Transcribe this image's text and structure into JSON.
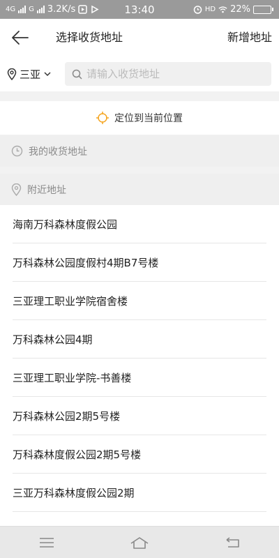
{
  "status_bar": {
    "network_1": "4G",
    "network_2": "G",
    "speed": "3.2K/s",
    "time": "13:40",
    "hd": "HD",
    "battery": "22%",
    "battery_level": 0.22
  },
  "header": {
    "title": "选择收货地址",
    "add_label": "新增地址"
  },
  "search_row": {
    "city": "三亚",
    "search_placeholder": "请输入收货地址"
  },
  "locate": {
    "label": "定位到当前位置",
    "accent": "#f5a623"
  },
  "sections": {
    "my_addresses": "我的收货地址",
    "nearby": "附近地址"
  },
  "nearby_list": [
    "海南万科森林度假公园",
    "万科森林公园度假村4期B7号楼",
    "三亚理工职业学院宿舍楼",
    "万科森林公园4期",
    "三亚理工职业学院-书善楼",
    "万科森林公园2期5号楼",
    "万科森林度假公园2期5号楼",
    "三亚万科森林度假公园2期",
    ""
  ],
  "icons": {
    "back": "arrow-left-icon",
    "location_pin": "location-pin-icon",
    "chevron": "chevron-down-icon",
    "search": "search-icon",
    "locate": "crosshair-icon",
    "clock": "clock-icon",
    "nav_menu": "menu-icon",
    "nav_home": "home-icon",
    "nav_back": "back-icon"
  }
}
